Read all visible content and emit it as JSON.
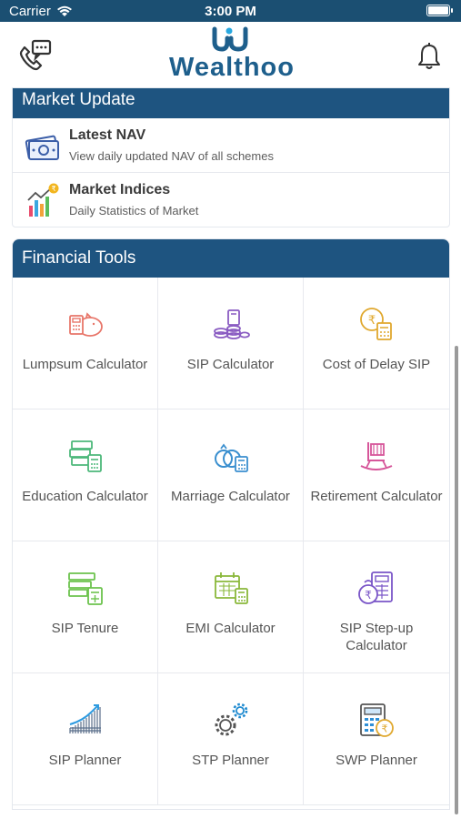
{
  "status_bar": {
    "carrier": "Carrier",
    "time": "3:00 PM"
  },
  "app": {
    "logo_text": "Wealthoo"
  },
  "market_update": {
    "title": "Market Update",
    "items": [
      {
        "title": "Latest NAV",
        "subtitle": "View daily updated NAV of all schemes",
        "icon": "currency-icon"
      },
      {
        "title": "Market Indices",
        "subtitle": "Daily Statistics of Market",
        "icon": "market-chart-icon"
      }
    ]
  },
  "financial_tools": {
    "title": "Financial Tools",
    "items": [
      {
        "label": "Lumpsum Calculator",
        "icon": "piggy-bank-icon"
      },
      {
        "label": "SIP Calculator",
        "icon": "coins-icon"
      },
      {
        "label": "Cost of Delay SIP",
        "icon": "rupee-calculator-icon"
      },
      {
        "label": "Education Calculator",
        "icon": "education-icon"
      },
      {
        "label": "Marriage Calculator",
        "icon": "rings-icon"
      },
      {
        "label": "Retirement Calculator",
        "icon": "rocking-chair-icon"
      },
      {
        "label": "SIP Tenure",
        "icon": "tenure-icon"
      },
      {
        "label": "EMI Calculator",
        "icon": "calendar-calculator-icon"
      },
      {
        "label": "SIP Step-up Calculator",
        "icon": "step-up-icon"
      },
      {
        "label": "SIP Planner",
        "icon": "growth-chart-icon"
      },
      {
        "label": "STP Planner",
        "icon": "gears-icon"
      },
      {
        "label": "SWP Planner",
        "icon": "swp-calculator-icon"
      }
    ]
  },
  "colors": {
    "header_bar": "#1e5480",
    "status_bar": "#1b4f72",
    "logo": "#1e5f8c"
  }
}
